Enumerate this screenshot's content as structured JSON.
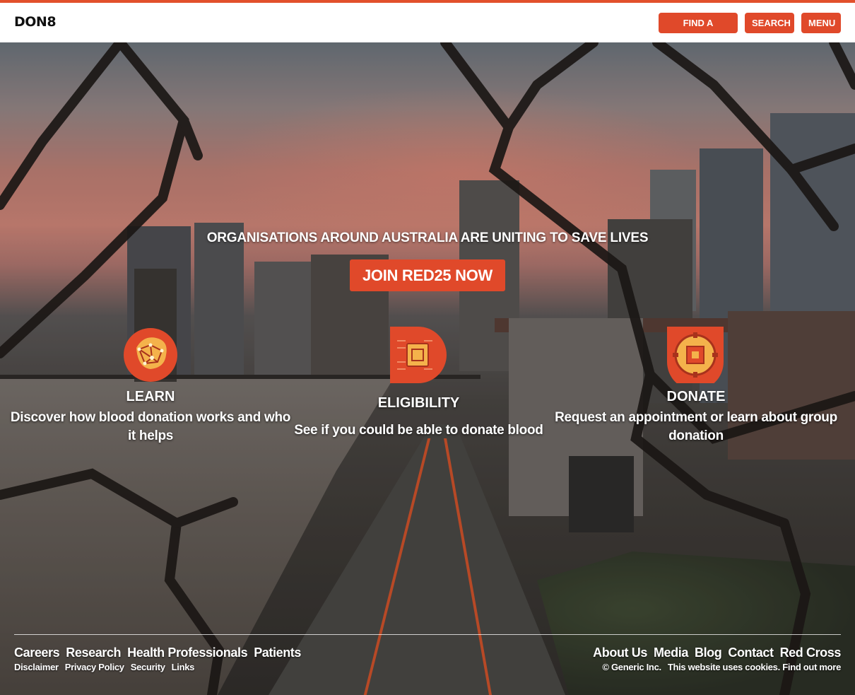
{
  "header": {
    "logo": "DON8",
    "buttons": {
      "find_centre": "FIND A CENTRE",
      "search": "SEARCH",
      "menu": "MENU"
    }
  },
  "hero": {
    "tagline": "ORGANISATIONS AROUND AUSTRALIA ARE UNITING TO SAVE LIVES",
    "cta": "JOIN RED25 NOW",
    "features": [
      {
        "title": "LEARN",
        "description": "Discover how blood donation works and who it helps",
        "icon": "brain-circuit-icon"
      },
      {
        "title": "ELIGIBILITY",
        "description": "See if you could be able to donate blood",
        "icon": "chip-icon"
      },
      {
        "title": "DONATE",
        "description": "Request an appointment or learn about group donation",
        "icon": "gear-chip-icon"
      }
    ]
  },
  "footer": {
    "primary_left": [
      "Careers",
      "Research",
      "Health Professionals",
      "Patients"
    ],
    "secondary_left": [
      "Disclaimer",
      "Privacy Policy",
      "Security",
      "Links"
    ],
    "primary_right": [
      "About Us",
      "Media",
      "Blog",
      "Contact",
      "Red Cross"
    ],
    "copyright": "© Generic Inc.",
    "cookie_notice": "This website uses cookies. Find out more"
  },
  "colors": {
    "accent": "#e0492a",
    "header_bg": "#ffffff",
    "text_on_hero": "#ffffff"
  }
}
